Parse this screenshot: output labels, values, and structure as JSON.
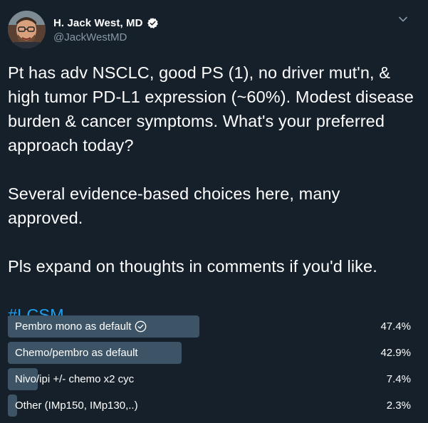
{
  "author": {
    "name": "H. Jack West, MD",
    "handle": "@JackWestMD",
    "verified": true
  },
  "tweet": {
    "paragraphs": [
      "Pt has adv NSCLC, good PS (1), no driver mut'n, & high tumor PD-L1 expression (~60%). Modest disease burden & cancer symptoms. What's your preferred approach today?",
      "Several evidence-based choices here, many approved.",
      "Pls expand on thoughts in comments if you'd like."
    ],
    "hashtag": "#LCSM"
  },
  "poll": {
    "options": [
      {
        "label": "Pembro mono as default",
        "percent_text": "47.4%",
        "fraction": 0.474,
        "selected": true
      },
      {
        "label": "Chemo/pembro as default",
        "percent_text": "42.9%",
        "fraction": 0.429,
        "selected": false
      },
      {
        "label": "Nivo/ipi +/- chemo x2 cyc",
        "percent_text": "7.4%",
        "fraction": 0.074,
        "selected": false
      },
      {
        "label": "Other (IMp150, IMp130,..)",
        "percent_text": "2.3%",
        "fraction": 0.023,
        "selected": false
      }
    ]
  },
  "colors": {
    "background": "#15202b",
    "text": "#ffffff",
    "secondary_text": "#8899a6",
    "link": "#1da1f2",
    "poll_bar": "#3d5466"
  },
  "icons": {
    "verified": "verified-badge-icon",
    "chevron": "chevron-down-icon",
    "selected": "check-circle-icon"
  }
}
